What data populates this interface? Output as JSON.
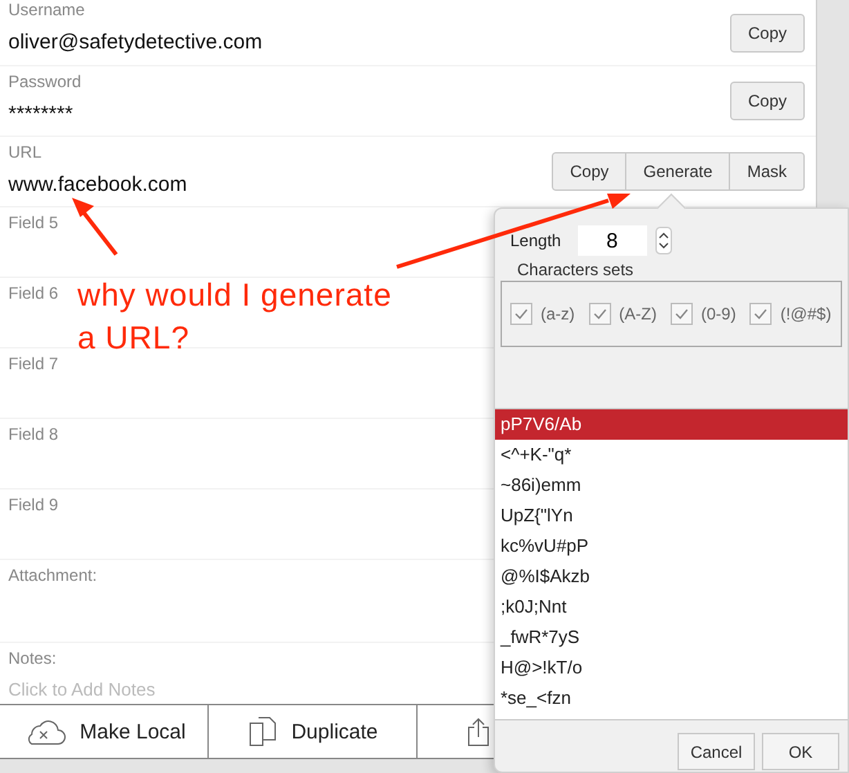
{
  "fields": [
    {
      "label": "Username",
      "value": "oliver@safetydetective.com",
      "actions": [
        "Copy"
      ]
    },
    {
      "label": "Password",
      "value": "********",
      "actions": [
        "Copy"
      ]
    },
    {
      "label": "URL",
      "value": "www.facebook.com",
      "actions": [
        "Copy",
        "Generate",
        "Mask"
      ]
    },
    {
      "label": "Field 5"
    },
    {
      "label": "Field 6"
    },
    {
      "label": "Field 7"
    },
    {
      "label": "Field 8"
    },
    {
      "label": "Field 9"
    }
  ],
  "attachment": {
    "label": "Attachment:"
  },
  "notes": {
    "label": "Notes:",
    "placeholder": "Click to Add Notes"
  },
  "toolbar": [
    {
      "kind": "cloud",
      "label": "Make Local"
    },
    {
      "kind": "duplicate",
      "label": "Duplicate"
    },
    {
      "kind": "share"
    }
  ],
  "generator": {
    "length_label": "Length",
    "length": "8",
    "charsets_title": "Characters sets",
    "charsets": [
      {
        "label": "(a-z)",
        "checked": true
      },
      {
        "label": "(A-Z)",
        "checked": true
      },
      {
        "label": "(0-9)",
        "checked": true
      },
      {
        "label": "(!@#$)",
        "checked": true
      }
    ],
    "passwords": [
      {
        "text": "pP7V6/Ab",
        "selected": true
      },
      {
        "text": "<^+K-\"q*",
        "selected": false
      },
      {
        "text": "~86i)emm",
        "selected": false
      },
      {
        "text": "UpZ{\"lYn",
        "selected": false
      },
      {
        "text": "kc%vU#pP",
        "selected": false
      },
      {
        "text": "@%I$Akzb",
        "selected": false
      },
      {
        "text": ";k0J;Nnt",
        "selected": false
      },
      {
        "text": "_fwR*7yS",
        "selected": false
      },
      {
        "text": "H@>!kT/o",
        "selected": false
      },
      {
        "text": "*se_<fzn",
        "selected": false
      }
    ],
    "buttons": [
      "Cancel",
      "OK"
    ]
  },
  "annotation": {
    "text": "why would I generate a URL?"
  }
}
